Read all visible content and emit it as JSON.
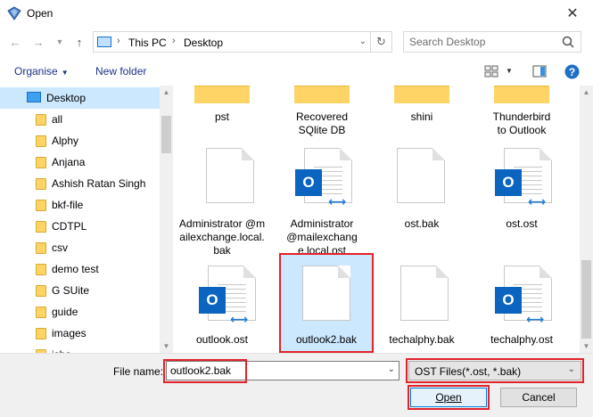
{
  "window": {
    "title": "Open"
  },
  "address": {
    "segments": [
      "This PC",
      "Desktop"
    ]
  },
  "search": {
    "placeholder": "Search Desktop"
  },
  "toolbar": {
    "organise": "Organise",
    "new_folder": "New folder"
  },
  "sidebar": {
    "items": [
      {
        "label": "Desktop",
        "selected": true
      },
      {
        "label": "all"
      },
      {
        "label": "Alphy"
      },
      {
        "label": "Anjana"
      },
      {
        "label": "Ashish Ratan Singh"
      },
      {
        "label": "bkf-file"
      },
      {
        "label": "CDTPL"
      },
      {
        "label": "csv"
      },
      {
        "label": "demo test"
      },
      {
        "label": "G SUite"
      },
      {
        "label": "guide"
      },
      {
        "label": "images"
      },
      {
        "label": "isba"
      }
    ]
  },
  "files": [
    {
      "label": "pst",
      "icon": "folder-icon"
    },
    {
      "label": "Recovered\nSQlite DB",
      "icon": "folder-icon"
    },
    {
      "label": "shini",
      "icon": "folder-icon"
    },
    {
      "label": "Thunderbird\nto Outlook",
      "icon": "folder-icon"
    },
    {
      "label": "Administrator\n@mailexchange.local.bak",
      "icon": "document-icon"
    },
    {
      "label": "Administrator\n@mailexchang\ne.local.ost",
      "icon": "outlook-ost-icon"
    },
    {
      "label": "ost.bak",
      "icon": "document-icon"
    },
    {
      "label": "ost.ost",
      "icon": "outlook-ost-icon"
    },
    {
      "label": "outlook.ost",
      "icon": "outlook-ost-icon"
    },
    {
      "label": "outlook2.bak",
      "icon": "document-icon",
      "selected": true
    },
    {
      "label": "techalphy.bak",
      "icon": "document-icon"
    },
    {
      "label": "techalphy.ost",
      "icon": "outlook-ost-icon"
    }
  ],
  "bottom": {
    "file_name_label": "File name:",
    "file_name_value": "outlook2.bak",
    "filter_value": "OST Files(*.ost, *.bak)",
    "open_label": "Open",
    "cancel_label": "Cancel"
  },
  "colors": {
    "highlight": "#e3222b",
    "selection": "#cce8ff",
    "accent": "#0078d7"
  }
}
